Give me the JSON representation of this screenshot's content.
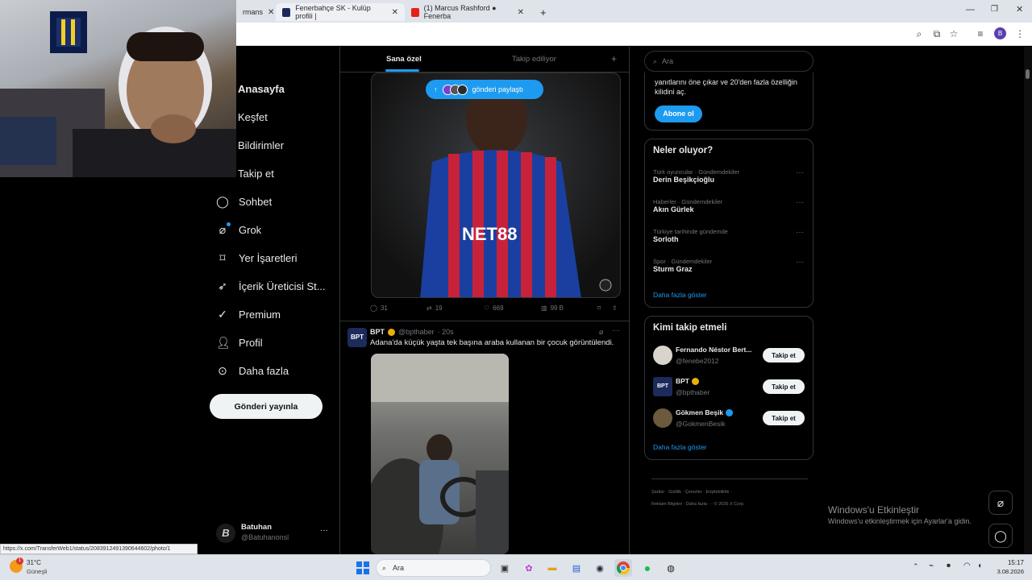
{
  "browser": {
    "tabs": [
      {
        "label": "rmans"
      },
      {
        "label": "Fenerbahçe SK - Kulüp profili |"
      },
      {
        "label": "(1) Marcus Rashford ● Fenerba"
      }
    ],
    "profile_initial": "B"
  },
  "sidebar": {
    "items": [
      {
        "label": "Anasayfa"
      },
      {
        "label": "Keşfet"
      },
      {
        "label": "Bildirimler"
      },
      {
        "label": "Takip et"
      },
      {
        "label": "Sohbet"
      },
      {
        "label": "Grok"
      },
      {
        "label": "Yer İşaretleri"
      },
      {
        "label": "İçerik Üreticisi St..."
      },
      {
        "label": "Premium"
      },
      {
        "label": "Profil"
      },
      {
        "label": "Daha fazla"
      }
    ],
    "post_button": "Gönderi yayınla",
    "account": {
      "name": "Batuhan",
      "handle": "@Batuhanonsl",
      "more": "···"
    }
  },
  "feed": {
    "tabs": [
      {
        "label": "Sana özel"
      },
      {
        "label": "Takip ediliyor"
      }
    ],
    "add_tab": "+",
    "share_pill": "gönderi paylaştı",
    "post1": {
      "actions": {
        "replies": "31",
        "reposts": "19",
        "likes": "669",
        "views": "99 B"
      }
    },
    "post2": {
      "author": "BPT",
      "handle": "@bpthaber",
      "time": "· 20s",
      "text": "Adana'da küçük yaşta tek başına araba kullanan bir çocuk görüntülendi.",
      "avatar_text": "BPT"
    }
  },
  "right": {
    "search_placeholder": "Ara",
    "premium_text": "yanıtlarını öne çıkar ve 20'den fazla özelliğin kilidini aç.",
    "subscribe": "Abone ol",
    "trends_title": "Neler oluyor?",
    "trends": [
      {
        "meta": "Türk oyuncular · Gündemdekiler",
        "name": "Derin Beşikçioğlu"
      },
      {
        "meta": "Haberler · Gündemdekiler",
        "name": "Akın Gürlek"
      },
      {
        "meta": "Türkiye tarihinde gündemde",
        "name": "Sorloth"
      },
      {
        "meta": "Spor · Gündemdekiler",
        "name": "Sturm Graz"
      }
    ],
    "show_more": "Daha fazla göster",
    "follow_title": "Kimi takip etmeli",
    "follow": [
      {
        "name": "Fernando Néstor Bert...",
        "handle": "@fenebe2012",
        "button": "Takip et"
      },
      {
        "name": "BPT",
        "handle": "@bpthaber",
        "button": "Takip et"
      },
      {
        "name": "Gökmen Beşik",
        "handle": "@GokmenBesik",
        "button": "Takip et"
      }
    ],
    "show_more2": "Daha fazla göster",
    "footer_line1": "Şartlar  ·  Gizlilik  ·  Çerezler  ·  Erişilebilirlik  ·",
    "footer_line2": "Reklam Bilgileri  ·  Daha fazla ···  © 2026 X Corp."
  },
  "status_url": "https://x.com/TransferWeb1/status/2083912491390644602/photo/1",
  "windows_watermark": {
    "title": "Windows'u Etkinleştir",
    "subtitle": "Windows'u etkinleştirmek için Ayarlar'a gidin."
  },
  "taskbar": {
    "weather_temp": "31°C",
    "weather_desc": "Güneşli",
    "search": "Ara",
    "time": "15:17",
    "date": "3.08.2026"
  },
  "colors": {
    "accent": "#1d9bf0",
    "background": "#000000",
    "border": "#2f3336"
  }
}
